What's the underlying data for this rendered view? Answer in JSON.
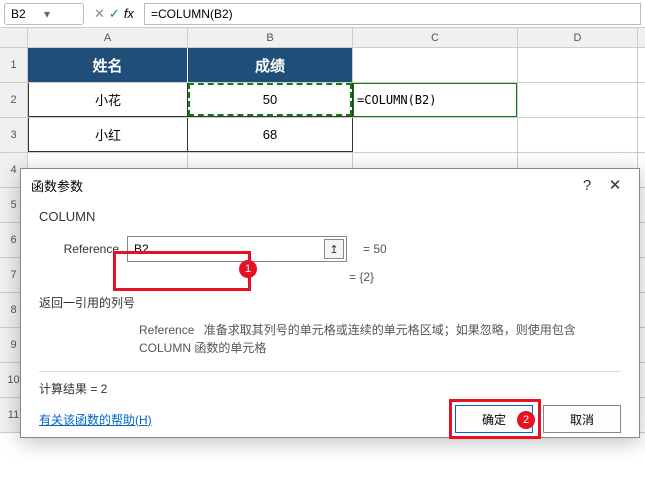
{
  "name_box": "B2",
  "formula_bar": "=COLUMN(B2)",
  "columns": [
    "A",
    "B",
    "C",
    "D"
  ],
  "rows": [
    "1",
    "2",
    "3",
    "4",
    "5",
    "6",
    "7",
    "8",
    "9",
    "10",
    "11"
  ],
  "headers": {
    "name": "姓名",
    "score": "成绩"
  },
  "data": [
    {
      "name": "小花",
      "score": "50"
    },
    {
      "name": "小红",
      "score": "68"
    }
  ],
  "editing_cell_text": "=COLUMN(B2)",
  "dialog": {
    "title": "函数参数",
    "fn": "COLUMN",
    "ref_label": "Reference",
    "ref_value": "B2",
    "eq1": "= 50",
    "eq2": "= {2}",
    "desc1": "返回一引用的列号",
    "desc2_label": "Reference",
    "desc2_text": "准备求取其列号的单元格或连续的单元格区域；如果忽略，则使用包含 COLUMN 函数的单元格",
    "result_label": "计算结果 = 2",
    "help": "有关该函数的帮助(H)",
    "ok": "确定",
    "cancel": "取消",
    "badge1": "1",
    "badge2": "2"
  }
}
